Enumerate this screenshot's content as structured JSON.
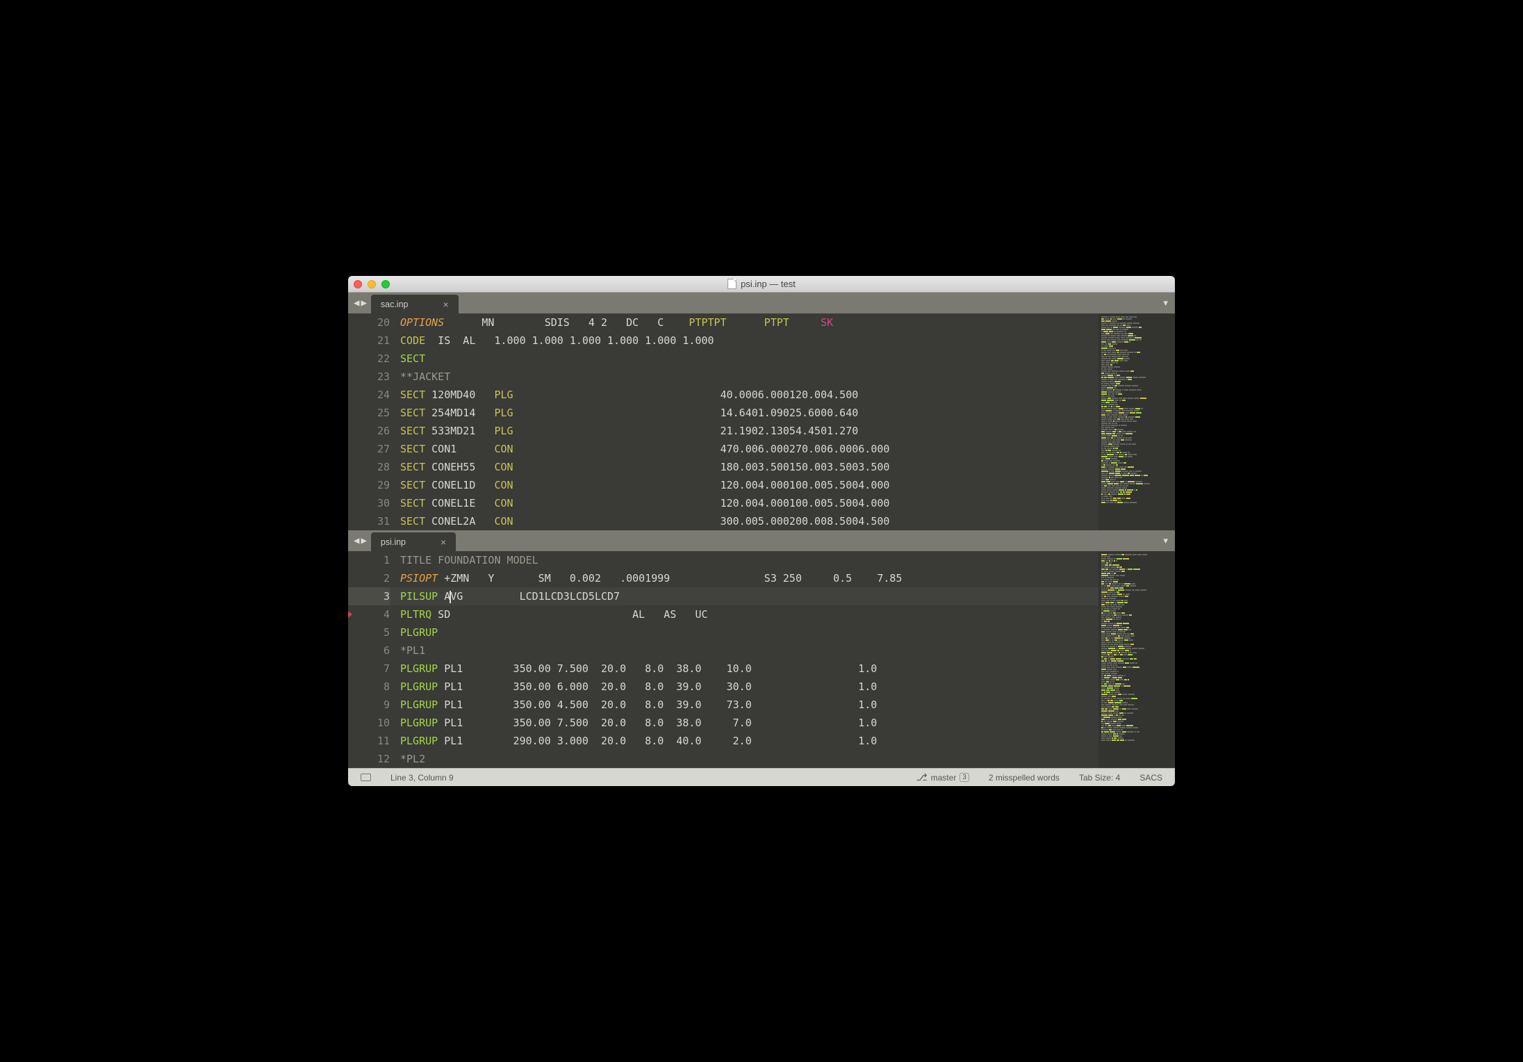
{
  "window_title": "psi.inp — test",
  "pane1": {
    "tab": "sac.inp",
    "first_line": 20,
    "lines": [
      {
        "spans": [
          {
            "cls": "kw-options",
            "t": "OPTIONS"
          },
          {
            "cls": "txt",
            "t": "      MN        SDIS   4 2   DC   C    "
          },
          {
            "cls": "kw-yellow",
            "t": "PTPTPT"
          },
          {
            "cls": "txt",
            "t": "      "
          },
          {
            "cls": "kw-yellow",
            "t": "PTPT"
          },
          {
            "cls": "txt",
            "t": "     "
          },
          {
            "cls": "kw-magenta",
            "t": "SK"
          }
        ]
      },
      {
        "spans": [
          {
            "cls": "kw-yellow",
            "t": "CODE"
          },
          {
            "cls": "txt",
            "t": "  IS  AL   1.000 1.000 1.000 1.000 1.000 1.000"
          }
        ]
      },
      {
        "spans": [
          {
            "cls": "kw-green",
            "t": "SECT"
          }
        ]
      },
      {
        "spans": [
          {
            "cls": "comment",
            "t": "**JACKET"
          }
        ]
      },
      {
        "spans": [
          {
            "cls": "kw-yellow",
            "t": "SECT"
          },
          {
            "cls": "txt",
            "t": " 120MD40   "
          },
          {
            "cls": "kw-yellow",
            "t": "PLG"
          },
          {
            "cls": "txt",
            "t": "                                 40.0006.000120.004.500"
          }
        ]
      },
      {
        "spans": [
          {
            "cls": "kw-yellow",
            "t": "SECT"
          },
          {
            "cls": "txt",
            "t": " 254MD14   "
          },
          {
            "cls": "kw-yellow",
            "t": "PLG"
          },
          {
            "cls": "txt",
            "t": "                                 14.6401.09025.6000.640"
          }
        ]
      },
      {
        "spans": [
          {
            "cls": "kw-yellow",
            "t": "SECT"
          },
          {
            "cls": "txt",
            "t": " 533MD21   "
          },
          {
            "cls": "kw-yellow",
            "t": "PLG"
          },
          {
            "cls": "txt",
            "t": "                                 21.1902.13054.4501.270"
          }
        ]
      },
      {
        "spans": [
          {
            "cls": "kw-yellow",
            "t": "SECT"
          },
          {
            "cls": "txt",
            "t": " CON1      "
          },
          {
            "cls": "kw-yellow",
            "t": "CON"
          },
          {
            "cls": "txt",
            "t": "                                 470.006.000270.006.0006.000"
          }
        ]
      },
      {
        "spans": [
          {
            "cls": "kw-yellow",
            "t": "SECT"
          },
          {
            "cls": "txt",
            "t": " CONEH55   "
          },
          {
            "cls": "kw-yellow",
            "t": "CON"
          },
          {
            "cls": "txt",
            "t": "                                 180.003.500150.003.5003.500"
          }
        ]
      },
      {
        "spans": [
          {
            "cls": "kw-yellow",
            "t": "SECT"
          },
          {
            "cls": "txt",
            "t": " CONEL1D   "
          },
          {
            "cls": "kw-yellow",
            "t": "CON"
          },
          {
            "cls": "txt",
            "t": "                                 120.004.000100.005.5004.000"
          }
        ]
      },
      {
        "spans": [
          {
            "cls": "kw-yellow",
            "t": "SECT"
          },
          {
            "cls": "txt",
            "t": " CONEL1E   "
          },
          {
            "cls": "kw-yellow",
            "t": "CON"
          },
          {
            "cls": "txt",
            "t": "                                 120.004.000100.005.5004.000"
          }
        ]
      },
      {
        "spans": [
          {
            "cls": "kw-yellow",
            "t": "SECT"
          },
          {
            "cls": "txt",
            "t": " CONEL2A   "
          },
          {
            "cls": "kw-yellow",
            "t": "CON"
          },
          {
            "cls": "txt",
            "t": "                                 300.005.000200.008.5004.500"
          }
        ]
      }
    ]
  },
  "pane2": {
    "tab": "psi.inp",
    "first_line": 1,
    "current_line_index": 2,
    "marker_line_index": 3,
    "lines": [
      {
        "spans": [
          {
            "cls": "comment",
            "t": "TITLE FOUNDATION MODEL"
          }
        ]
      },
      {
        "spans": [
          {
            "cls": "kw-options",
            "t": "PSIOPT"
          },
          {
            "cls": "txt",
            "t": " +ZMN   Y       SM   0.002   .0001999               S3 250     0.5    7.85"
          }
        ]
      },
      {
        "current": true,
        "spans": [
          {
            "cls": "kw-green",
            "t": "PILSUP"
          },
          {
            "cls": "txt",
            "t": " A"
          },
          {
            "cursor": true
          },
          {
            "cls": "txt",
            "t": "VG         LCD1LCD3LCD5LCD7"
          }
        ]
      },
      {
        "spans": [
          {
            "cls": "kw-green",
            "t": "PLTRQ"
          },
          {
            "cls": "txt",
            "t": " SD                             AL   AS   UC"
          }
        ]
      },
      {
        "spans": [
          {
            "cls": "kw-green",
            "t": "PLGRUP"
          }
        ]
      },
      {
        "spans": [
          {
            "cls": "comment",
            "t": "*PL1"
          }
        ]
      },
      {
        "spans": [
          {
            "cls": "kw-green",
            "t": "PLGRUP"
          },
          {
            "cls": "txt",
            "t": " PL1        350.00 7.500  20.0   8.0  38.0    10.0                 1.0"
          }
        ]
      },
      {
        "spans": [
          {
            "cls": "kw-green",
            "t": "PLGRUP"
          },
          {
            "cls": "txt",
            "t": " PL1        350.00 6.000  20.0   8.0  39.0    30.0                 1.0"
          }
        ]
      },
      {
        "spans": [
          {
            "cls": "kw-green",
            "t": "PLGRUP"
          },
          {
            "cls": "txt",
            "t": " PL1        350.00 4.500  20.0   8.0  39.0    73.0                 1.0"
          }
        ]
      },
      {
        "spans": [
          {
            "cls": "kw-green",
            "t": "PLGRUP"
          },
          {
            "cls": "txt",
            "t": " PL1        350.00 7.500  20.0   8.0  38.0     7.0                 1.0"
          }
        ]
      },
      {
        "spans": [
          {
            "cls": "kw-green",
            "t": "PLGRUP"
          },
          {
            "cls": "txt",
            "t": " PL1        290.00 3.000  20.0   8.0  40.0     2.0                 1.0"
          }
        ]
      },
      {
        "spans": [
          {
            "cls": "comment",
            "t": "*PL2"
          }
        ]
      }
    ]
  },
  "status": {
    "cursor": "Line 3, Column 9",
    "branch": "master",
    "branch_badge": "3",
    "spell": "2 misspelled words",
    "tabsize": "Tab Size: 4",
    "syntax": "SACS"
  }
}
